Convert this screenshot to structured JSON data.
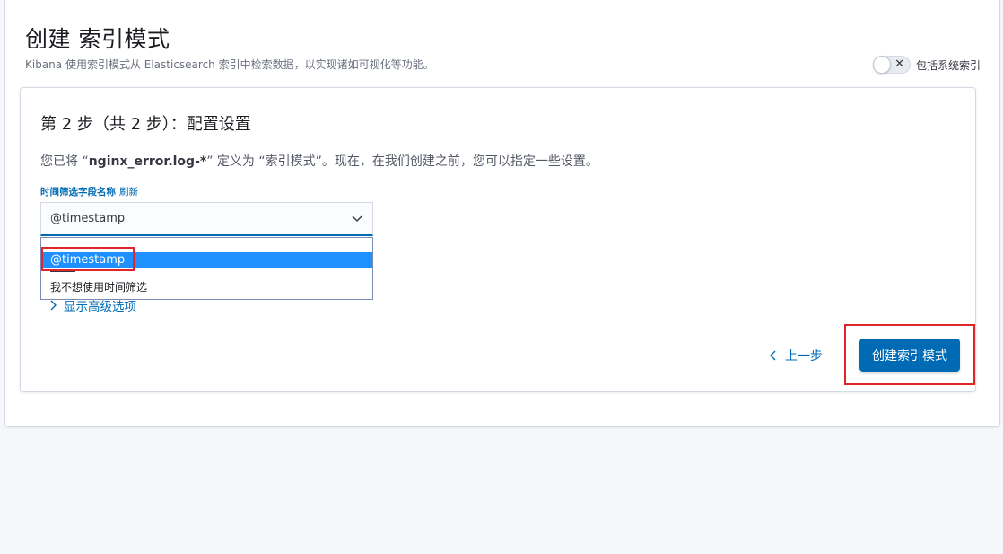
{
  "header": {
    "title": "创建 索引模式",
    "description": "Kibana 使用索引模式从 Elasticsearch 索引中检索数据，以实现诸如可视化等功能。",
    "include_system_label": "包括系统索引",
    "include_system_enabled": false
  },
  "step": {
    "title": "第 2 步（共 2 步）：配置设置",
    "desc_prefix": "您已将 “",
    "pattern": "nginx_error.log-*",
    "desc_suffix": "” 定义为 “索引模式”。现在，在我们创建之前，您可以指定一些设置。",
    "field_label": "时间筛选字段名称",
    "refresh_label": "刷新",
    "selected_value": "@timestamp",
    "options": [
      "@timestamp",
      "我不想使用时间筛选"
    ],
    "advanced_label": "显示高级选项",
    "back_label": "上一步",
    "create_label": "创建索引模式"
  },
  "colors": {
    "primary": "#006bb4",
    "highlight": "#e0262a",
    "selected_option": "#1e90ff"
  }
}
